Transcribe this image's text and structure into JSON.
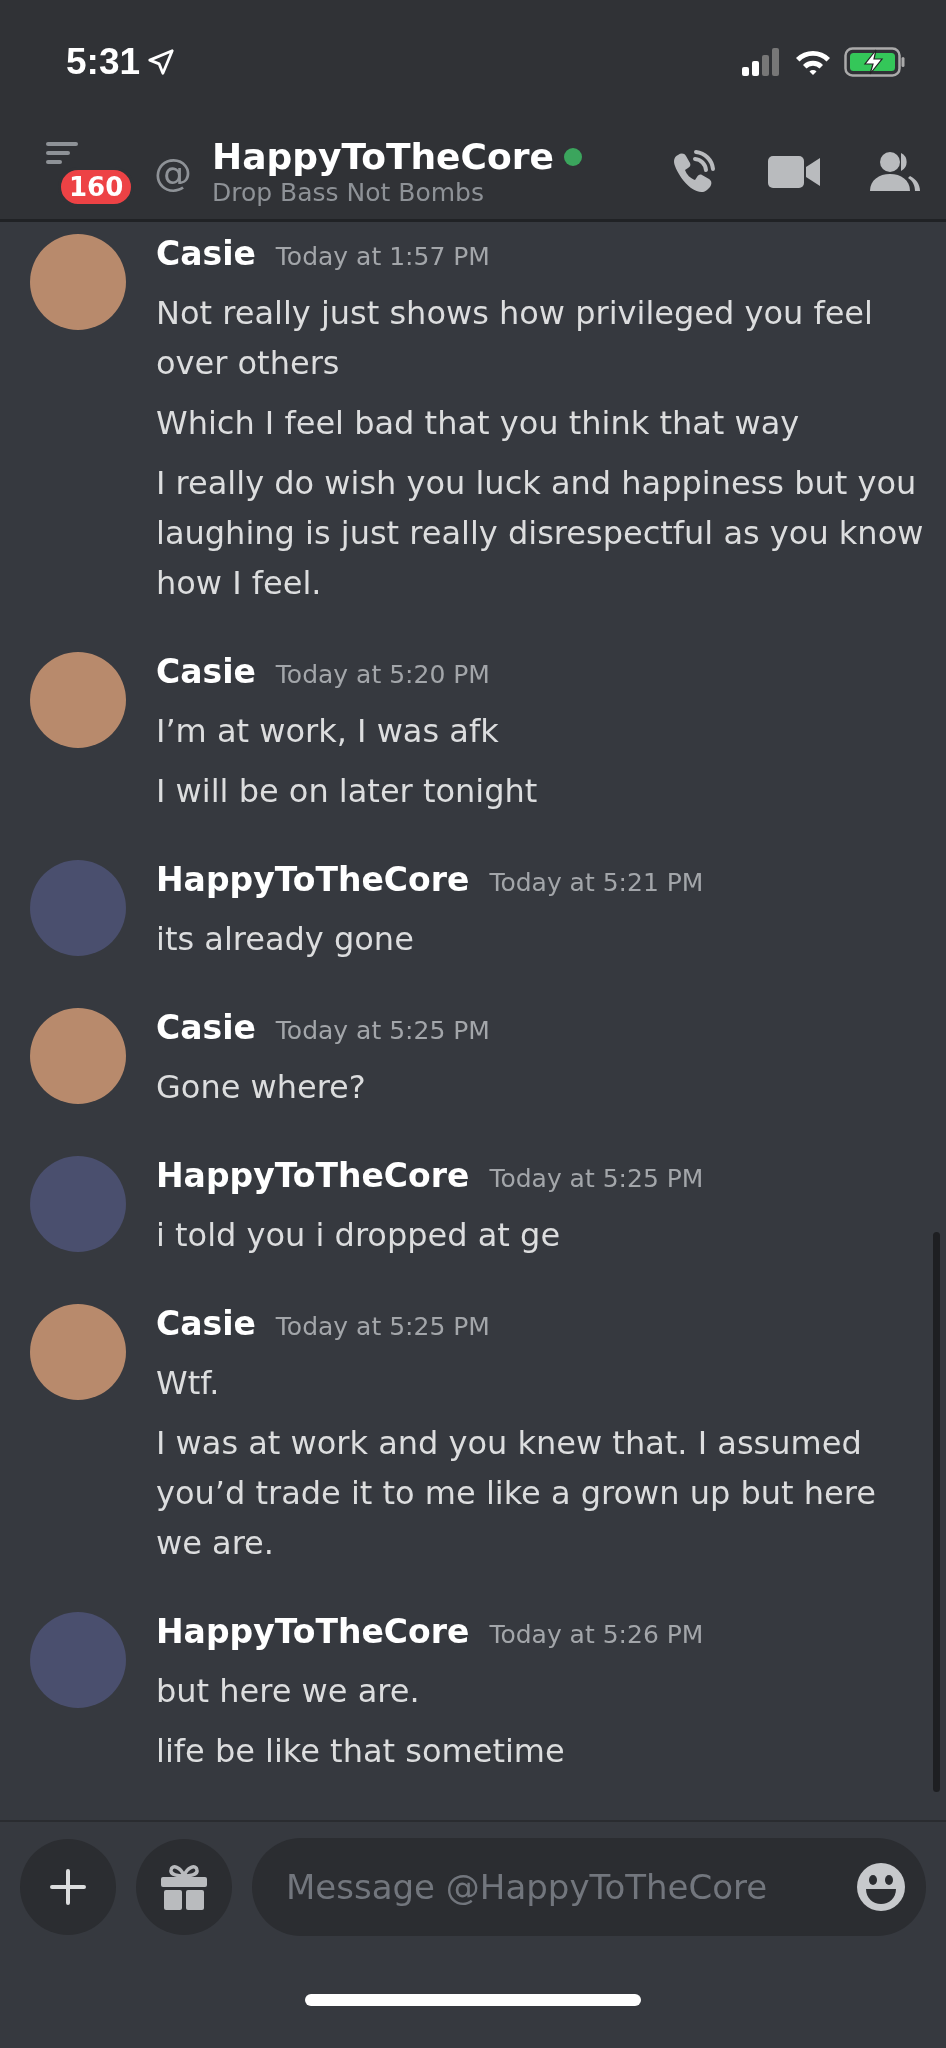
{
  "status_bar": {
    "time": "5:31"
  },
  "header": {
    "badge": "160",
    "at": "@",
    "title": "HappyToTheCore",
    "online": true,
    "subtitle": "Drop Bass Not Bombs"
  },
  "messages": [
    {
      "author": "Casie",
      "color": "#b88a6c",
      "timestamp": "Today at 1:57 PM",
      "lines": [
        "Not really just shows how privileged you feel over others",
        "Which I feel bad that you think that way",
        "I really do wish you luck and happiness but you laughing is just really disrespectful as you know how I feel."
      ]
    },
    {
      "author": "Casie",
      "color": "#b88a6c",
      "timestamp": "Today at 5:20 PM",
      "lines": [
        "I’m at work, I was afk",
        "I will be on later tonight"
      ]
    },
    {
      "author": "HappyToTheCore",
      "color": "#4a4f6e",
      "timestamp": "Today at 5:21 PM",
      "lines": [
        "its already gone"
      ]
    },
    {
      "author": "Casie",
      "color": "#b88a6c",
      "timestamp": "Today at 5:25 PM",
      "lines": [
        "Gone where?"
      ]
    },
    {
      "author": "HappyToTheCore",
      "color": "#4a4f6e",
      "timestamp": "Today at 5:25 PM",
      "lines": [
        "i told you i dropped at ge"
      ]
    },
    {
      "author": "Casie",
      "color": "#b88a6c",
      "timestamp": "Today at 5:25 PM",
      "lines": [
        "Wtf.",
        "I was at work and you knew that. I assumed you’d trade it to me like a grown up but here we are."
      ]
    },
    {
      "author": "HappyToTheCore",
      "color": "#4a4f6e",
      "timestamp": "Today at 5:26 PM",
      "lines": [
        "but here we are.",
        "life be like that sometime"
      ]
    }
  ],
  "composer": {
    "placeholder": "Message @HappyToTheCore"
  }
}
